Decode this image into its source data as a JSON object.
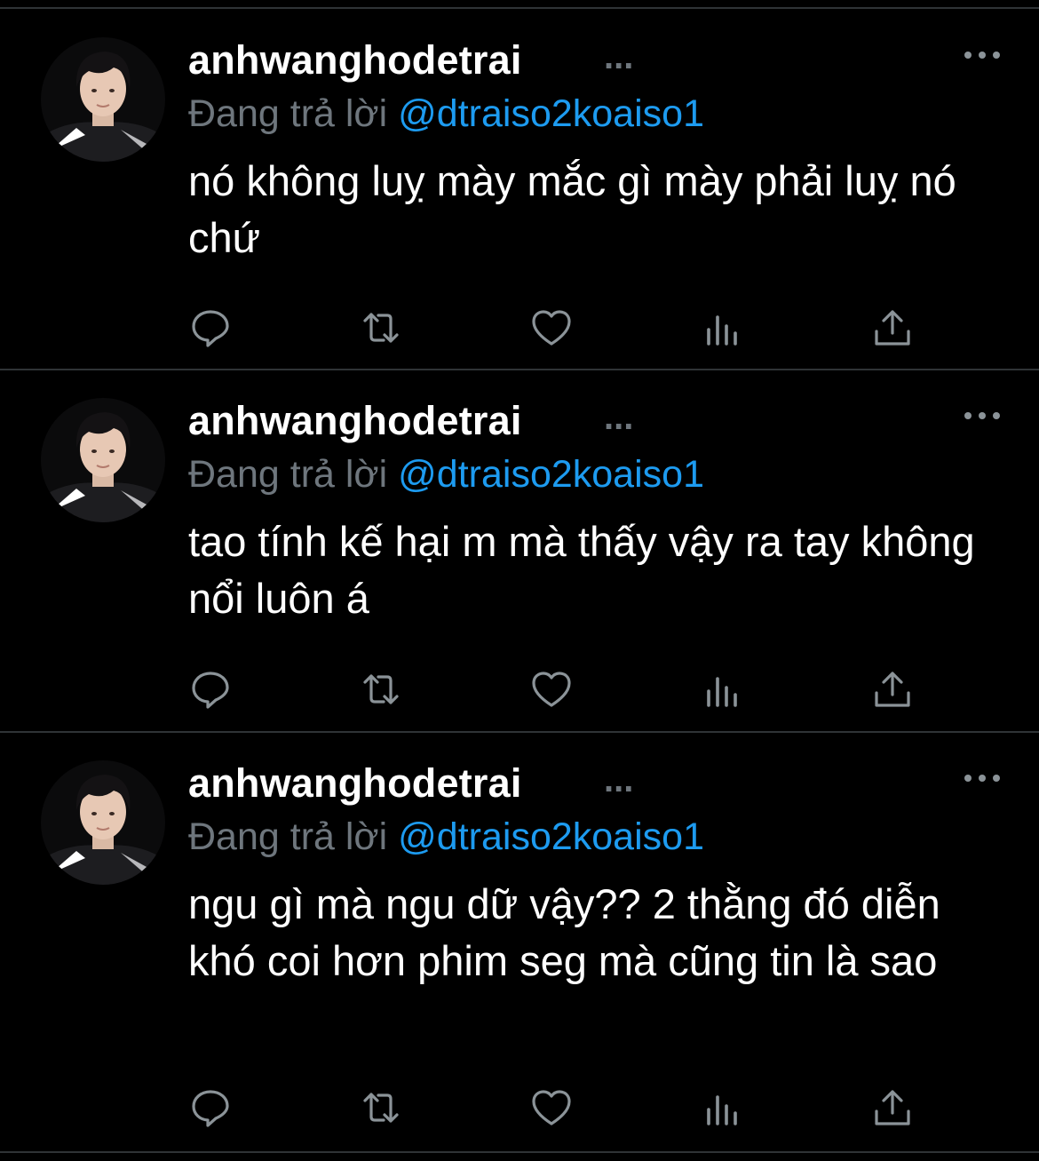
{
  "tweets": [
    {
      "username": "anhwanghodetrai",
      "ellipsis": "...",
      "reply_prefix": "Đang trả lời",
      "reply_handle": "@dtraiso2koaiso1",
      "text": "nó không luỵ mày mắc gì mày phải luỵ nó chứ"
    },
    {
      "username": "anhwanghodetrai",
      "ellipsis": "...",
      "reply_prefix": "Đang trả lời",
      "reply_handle": "@dtraiso2koaiso1",
      "text": "tao tính kế hại m mà thấy vậy ra tay không nổi luôn á"
    },
    {
      "username": "anhwanghodetrai",
      "ellipsis": "...",
      "reply_prefix": "Đang trả lời",
      "reply_handle": "@dtraiso2koaiso1",
      "text": "ngu gì mà ngu dữ vậy?? 2 thằng đó diễn khó coi hơn phim seg mà cũng tin là sao"
    }
  ],
  "icons": {
    "more": "more-horizontal-icon",
    "reply": "reply-bubble-icon",
    "retweet": "retweet-icon",
    "like": "heart-icon",
    "views": "analytics-bars-icon",
    "share": "share-upload-icon"
  },
  "colors": {
    "background": "#000000",
    "text": "#ffffff",
    "muted": "#6e767d",
    "link": "#1d9bf0",
    "divider": "#2f3336"
  }
}
